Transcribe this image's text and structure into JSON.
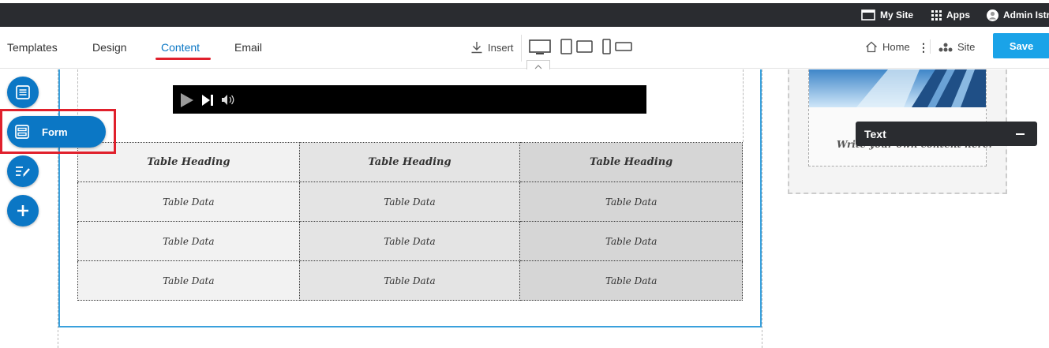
{
  "topbar": {
    "my_site": "My Site",
    "apps": "Apps",
    "admin": "Admin Istra"
  },
  "tabs": [
    {
      "label": "Templates"
    },
    {
      "label": "Design"
    },
    {
      "label": "Content",
      "active": true
    },
    {
      "label": "Email"
    }
  ],
  "toolbar": {
    "insert": "Insert",
    "home": "Home",
    "kebab": "⋮",
    "site": "Site",
    "save": "Save"
  },
  "sidebar": {
    "form_label": "Form"
  },
  "table": {
    "headings": [
      "Table Heading",
      "Table Heading",
      "Table Heading"
    ],
    "rows": [
      [
        "Table Data",
        "Table Data",
        "Table Data"
      ],
      [
        "Table Data",
        "Table Data",
        "Table Data"
      ],
      [
        "Table Data",
        "Table Data",
        "Table Data"
      ]
    ]
  },
  "right_panel": {
    "placeholder": "Write your own content here!",
    "tooltip_label": "Text"
  },
  "colors": {
    "accent": "#0b77c5",
    "save": "#1aa3e8",
    "highlight": "#e0202c",
    "topbar": "#2a2c30"
  }
}
